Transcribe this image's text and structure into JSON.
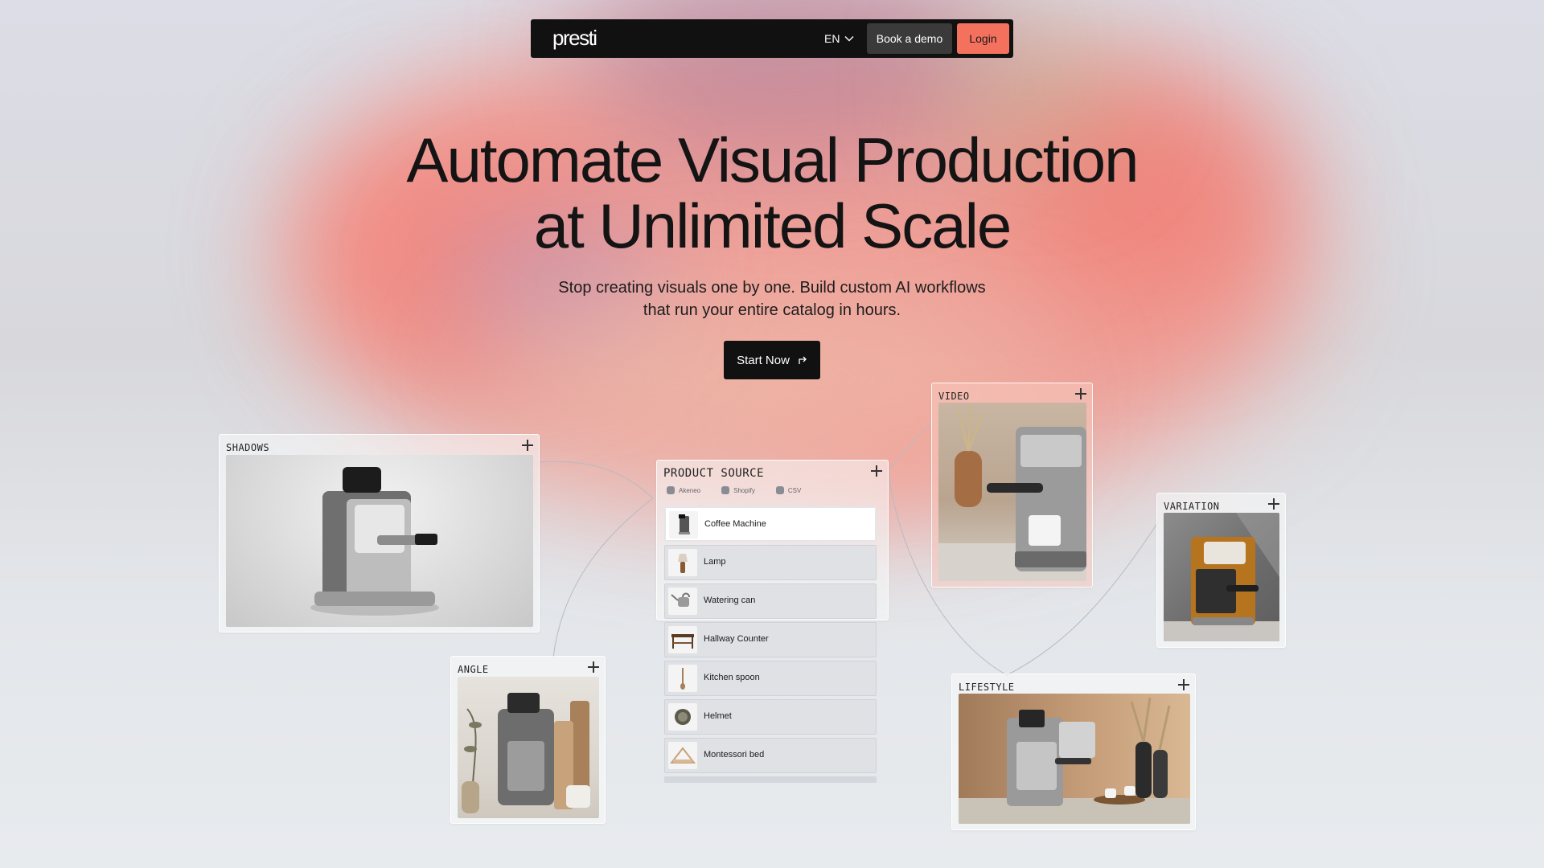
{
  "nav": {
    "logo": "presti",
    "lang": "EN",
    "demo_label": "Book a demo",
    "login_label": "Login"
  },
  "hero": {
    "title_line1": "Automate Visual Production",
    "title_line2": "at Unlimited Scale",
    "subtitle_line1": "Stop creating visuals one by one. Build custom AI workflows",
    "subtitle_line2": "that run your entire catalog in hours.",
    "cta_label": "Start Now"
  },
  "cards": {
    "shadows": "SHADOWS",
    "angle": "ANGLE",
    "video": "VIDEO",
    "variation": "VARIATION",
    "lifestyle": "LIFESTYLE"
  },
  "product_source": {
    "title": "PRODUCT SOURCE",
    "sources": [
      "Akeneo",
      "Shopify",
      "CSV"
    ],
    "items": [
      "Coffee Machine",
      "Lamp",
      "Watering can",
      "Hallway Counter",
      "Kitchen spoon",
      "Helmet",
      "Montessori bed"
    ]
  },
  "colors": {
    "accent": "#f4715e",
    "dark": "#111111"
  }
}
